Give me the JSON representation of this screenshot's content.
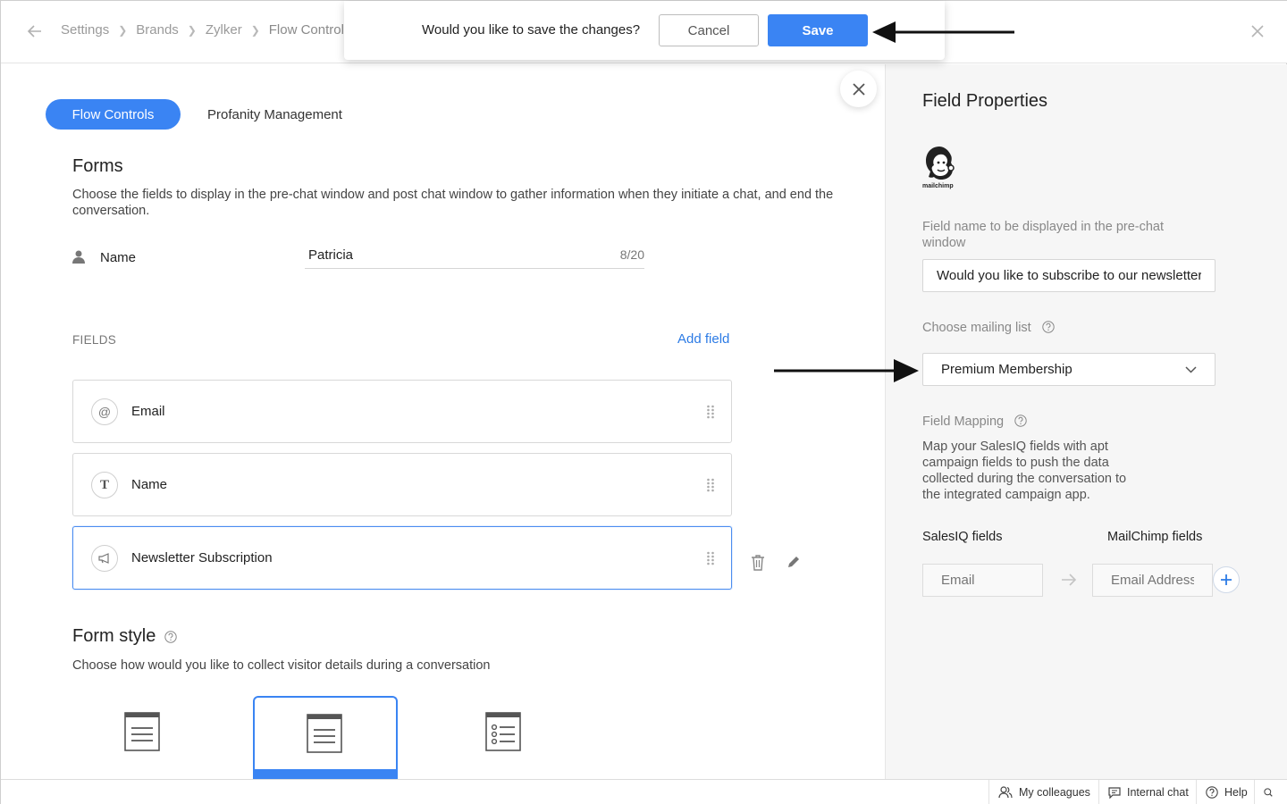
{
  "header": {
    "breadcrumbs": [
      "Settings",
      "Brands",
      "Zylker",
      "Flow Controls"
    ]
  },
  "save_dialog": {
    "message": "Would you like to save the changes?",
    "cancel_label": "Cancel",
    "save_label": "Save"
  },
  "tabs": [
    {
      "label": "Flow Controls",
      "active": true
    },
    {
      "label": "Profanity Management",
      "active": false
    }
  ],
  "forms": {
    "title": "Forms",
    "description": "Choose the fields to display in the pre-chat window and post chat window to gather information when they initiate a chat, and end the conversation.",
    "name_label": "Name",
    "name_value": "Patricia",
    "name_count": "8/20",
    "fields_label": "FIELDS",
    "add_field_label": "Add field",
    "fields": [
      {
        "name": "Email",
        "icon": "at-icon"
      },
      {
        "name": "Name",
        "icon": "text-icon"
      },
      {
        "name": "Newsletter Subscription",
        "icon": "megaphone-icon",
        "selected": true
      }
    ]
  },
  "form_style": {
    "title": "Form style",
    "description": "Choose how would you like to collect visitor details during a conversation"
  },
  "field_properties": {
    "title": "Field Properties",
    "logo_text": "mailchimp",
    "display_name_label": "Field name to be displayed in the pre-chat window",
    "display_name_value": "Would you like to subscribe to our newsletter?",
    "mailing_list_label": "Choose mailing list",
    "mailing_list_value": "Premium Membership",
    "field_mapping_label": "Field Mapping",
    "field_mapping_desc": "Map your SalesIQ fields with apt campaign fields to push the data collected during the conversation to the integrated campaign app.",
    "salesiq_col": "SalesIQ fields",
    "mailchimp_col": "MailChimp fields",
    "salesiq_placeholder": "Email",
    "mailchimp_placeholder": "Email Address"
  },
  "bottom_bar": {
    "colleagues": "My colleagues",
    "internal_chat": "Internal chat",
    "help": "Help"
  },
  "colors": {
    "accent": "#3a84f3",
    "link": "#2c7be5"
  }
}
